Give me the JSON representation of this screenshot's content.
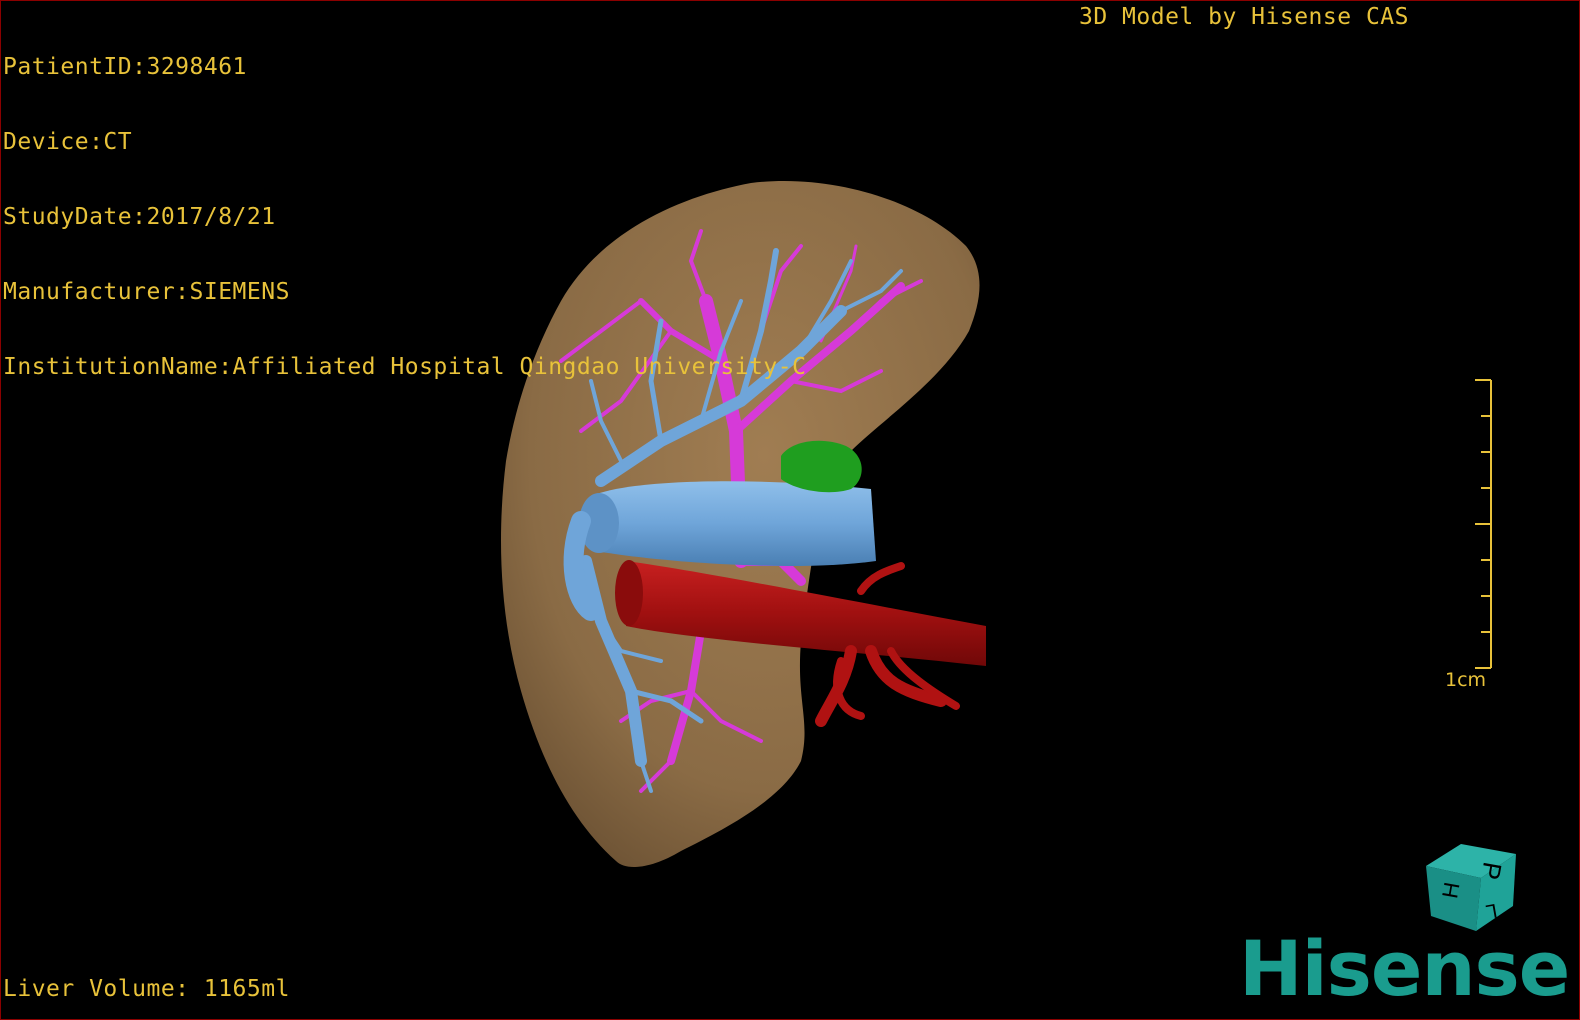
{
  "patient_info": {
    "patient_id": "PatientID:3298461",
    "device": "Device:CT",
    "study_date": "StudyDate:2017/8/21",
    "manufacturer": "Manufacturer:SIEMENS",
    "institution": "InstitutionName:Affiliated Hospital Qingdao University-C"
  },
  "model_credit": "3D Model by Hisense CAS",
  "liver_volume": "Liver Volume: 1165ml",
  "scale": {
    "label": "1cm"
  },
  "orientation_cube": {
    "faces": [
      "H",
      "P",
      "L"
    ]
  },
  "brand": {
    "logo_text": "Hisense"
  },
  "colors": {
    "overlay_text": "#e8c23a",
    "liver": "#8a6b45",
    "portal_vein": "#6fa5d9",
    "hepatic_vein": "#d63ad8",
    "artery": "#b01212",
    "lesion": "#1f9e1f",
    "brand": "#1a9c8e",
    "border": "#8b0000"
  }
}
